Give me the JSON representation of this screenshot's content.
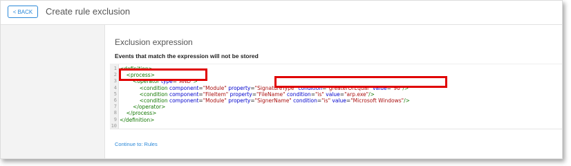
{
  "header": {
    "back_label": "BACK",
    "title": "Create rule exclusion"
  },
  "panel": {
    "title": "Exclusion expression",
    "subtitle": "Events that match the expression will not be stored"
  },
  "editor": {
    "line_numbers": [
      "1",
      "2",
      "3",
      "4",
      "5",
      "6",
      "7",
      "8",
      "9",
      "10"
    ],
    "lines": [
      {
        "indent": "",
        "parts": [
          {
            "c": "t",
            "v": "<definition>"
          }
        ]
      },
      {
        "indent": "    ",
        "parts": [
          {
            "c": "t",
            "v": "<process>"
          }
        ]
      },
      {
        "indent": "        ",
        "parts": [
          {
            "c": "t",
            "v": "<operator "
          },
          {
            "c": "a",
            "v": "type"
          },
          {
            "c": "",
            "v": "="
          },
          {
            "c": "s",
            "v": "\"AND\""
          },
          {
            "c": "t",
            "v": ">"
          }
        ]
      },
      {
        "indent": "            ",
        "parts": [
          {
            "c": "t",
            "v": "<condition "
          },
          {
            "c": "a",
            "v": "component"
          },
          {
            "c": "",
            "v": "="
          },
          {
            "c": "s",
            "v": "\"Module\""
          },
          {
            "c": "",
            "v": " "
          },
          {
            "c": "a",
            "v": "property"
          },
          {
            "c": "",
            "v": "="
          },
          {
            "c": "s",
            "v": "\"SignatureType\""
          },
          {
            "c": "",
            "v": " "
          },
          {
            "c": "a",
            "v": "condition"
          },
          {
            "c": "",
            "v": "="
          },
          {
            "c": "s",
            "v": "\"greaterOrEqual\""
          },
          {
            "c": "",
            "v": " "
          },
          {
            "c": "a",
            "v": "value"
          },
          {
            "c": "",
            "v": "="
          },
          {
            "c": "s",
            "v": "\"90\""
          },
          {
            "c": "t",
            "v": "/>"
          }
        ]
      },
      {
        "indent": "            ",
        "parts": [
          {
            "c": "t",
            "v": "<condition "
          },
          {
            "c": "a",
            "v": "component"
          },
          {
            "c": "",
            "v": "="
          },
          {
            "c": "s",
            "v": "\"FileItem\""
          },
          {
            "c": "",
            "v": " "
          },
          {
            "c": "a",
            "v": "property"
          },
          {
            "c": "",
            "v": "="
          },
          {
            "c": "s",
            "v": "\"FileName\""
          },
          {
            "c": "",
            "v": " "
          },
          {
            "c": "a",
            "v": "condition"
          },
          {
            "c": "",
            "v": "="
          },
          {
            "c": "s",
            "v": "\"is\""
          },
          {
            "c": "",
            "v": " "
          },
          {
            "c": "a",
            "v": "value"
          },
          {
            "c": "",
            "v": "="
          },
          {
            "c": "s",
            "v": "\"arp.exe\""
          },
          {
            "c": "t",
            "v": "/>"
          }
        ]
      },
      {
        "indent": "            ",
        "parts": [
          {
            "c": "t",
            "v": "<condition "
          },
          {
            "c": "a",
            "v": "component"
          },
          {
            "c": "",
            "v": "="
          },
          {
            "c": "s",
            "v": "\"Module\""
          },
          {
            "c": "",
            "v": " "
          },
          {
            "c": "a",
            "v": "property"
          },
          {
            "c": "",
            "v": "="
          },
          {
            "c": "s",
            "v": "\"SignerName\""
          },
          {
            "c": "",
            "v": " "
          },
          {
            "c": "a",
            "v": "condition"
          },
          {
            "c": "",
            "v": "="
          },
          {
            "c": "s",
            "v": "\"is\""
          },
          {
            "c": "",
            "v": " "
          },
          {
            "c": "a",
            "v": "value"
          },
          {
            "c": "",
            "v": "="
          },
          {
            "c": "s",
            "v": "\"Microsoft Windows\""
          },
          {
            "c": "t",
            "v": "/>"
          }
        ]
      },
      {
        "indent": "        ",
        "parts": [
          {
            "c": "t",
            "v": "</operator>"
          }
        ]
      },
      {
        "indent": "    ",
        "parts": [
          {
            "c": "t",
            "v": "</process>"
          }
        ]
      },
      {
        "indent": "",
        "parts": [
          {
            "c": "t",
            "v": "</definition>"
          }
        ]
      },
      {
        "indent": "",
        "parts": []
      }
    ]
  },
  "footer": {
    "continue_prefix": "Continue to:",
    "continue_link": "Rules"
  },
  "colors": {
    "accent": "#2b88d8",
    "highlight": "#e00000",
    "tag": "#117700",
    "attr": "#0000cc",
    "string": "#aa1111"
  }
}
